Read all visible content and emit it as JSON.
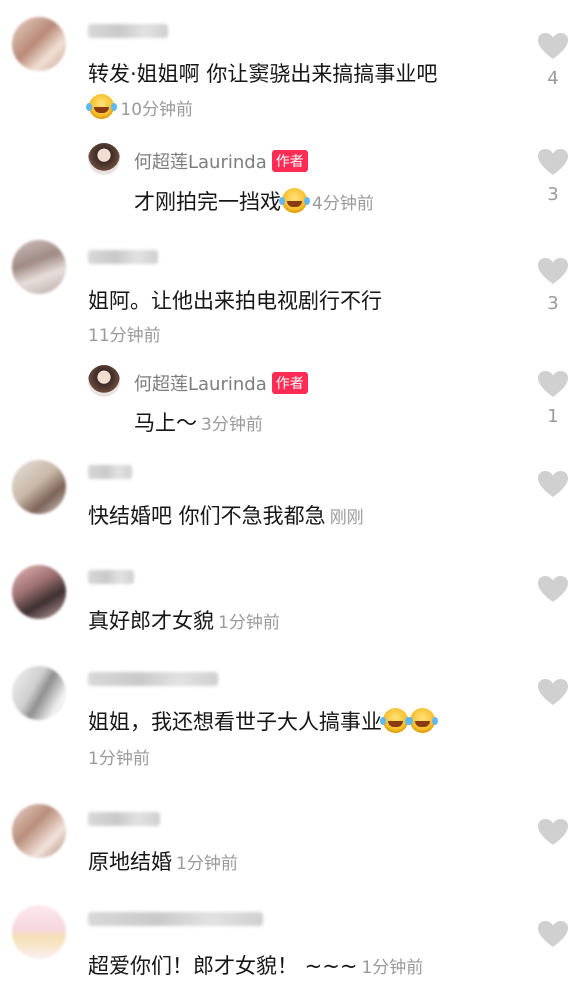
{
  "comments": [
    {
      "text": "转发·姐姐啊 你让窦骁出来搞搞事业吧",
      "time": "10分钟前",
      "likes": "4"
    },
    {
      "text": "姐阿。让他出来拍电视剧行不行",
      "time": "11分钟前",
      "likes": "3"
    },
    {
      "text": "快结婚吧 你们不急我都急",
      "time": "刚刚",
      "likes": ""
    },
    {
      "text": "真好郎才女貌",
      "time": "1分钟前",
      "likes": ""
    },
    {
      "text": "姐姐，我还想看世子大人搞事业",
      "time": "1分钟前",
      "likes": ""
    },
    {
      "text": "原地结婚",
      "time": "1分钟前",
      "likes": ""
    },
    {
      "text": "超爱你们！郎才女貌！ ~~~",
      "time": "1分钟前",
      "likes": ""
    }
  ],
  "replies": [
    {
      "author": "何超莲Laurinda",
      "badge": "作者",
      "text": "才刚拍完一挡戏",
      "time": "4分钟前",
      "likes": "3"
    },
    {
      "author": "何超莲Laurinda",
      "badge": "作者",
      "text": "马上～",
      "time": "3分钟前",
      "likes": "1"
    }
  ],
  "emoji": "laugh-cry-emoji",
  "colors": {
    "badge": "#fe2c55",
    "muted": "#9a9a9a",
    "heart": "#d0d0d0"
  }
}
